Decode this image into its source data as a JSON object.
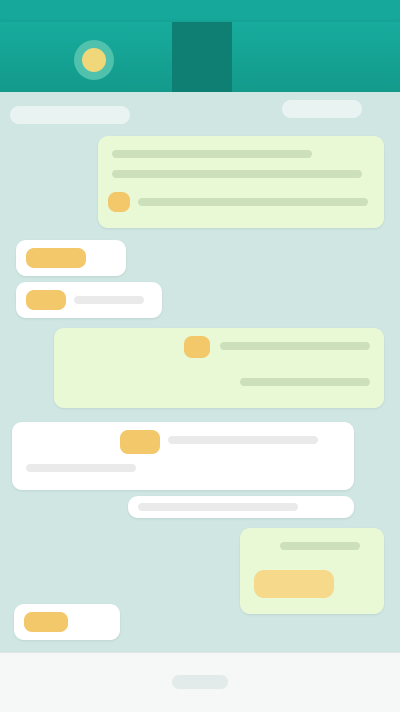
{
  "header": {
    "contact_name": "",
    "status": ""
  },
  "chat": {
    "messages": []
  },
  "composer": {
    "placeholder": ""
  }
}
